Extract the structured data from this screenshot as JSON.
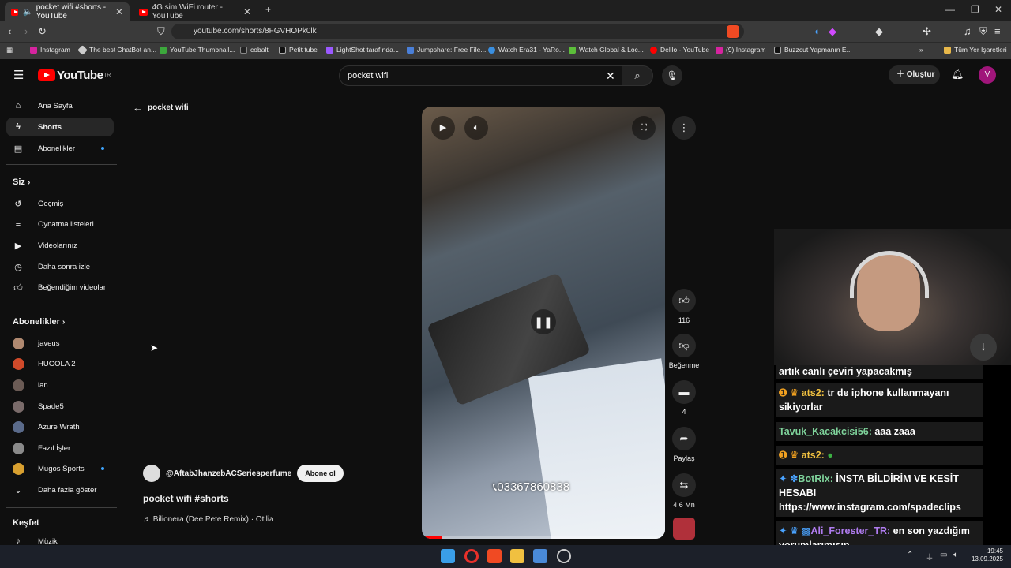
{
  "browser": {
    "tabs": [
      {
        "label": "pocket wifi #shorts - YouTube",
        "active": true
      },
      {
        "label": "4G sim WiFi router - YouTube",
        "active": false
      }
    ],
    "url": "youtube.com/shorts/8FGVHOPk0lk",
    "bookmarks": [
      "Instagram",
      "The best ChatBot an...",
      "YouTube Thumbnail...",
      "cobalt",
      "Petit tube",
      "LightShot tarafında...",
      "Jumpshare: Free File...",
      "Watch Era31 - YaRo...",
      "Watch Global & Loc...",
      "Delilo - YouTube",
      "(9) Instagram",
      "Buzzcut Yapmanın E..."
    ],
    "all_bookmarks": "Tüm Yer İşaretleri"
  },
  "youtube": {
    "logo_region": "TR",
    "search_value": "pocket wifi",
    "create_label": "Oluştur",
    "avatar_letter": "V",
    "sidebar": {
      "main": [
        "Ana Sayfa",
        "Shorts",
        "Abonelikler"
      ],
      "you_header": "Siz",
      "you_items": [
        "Geçmiş",
        "Oynatma listeleri",
        "Videolarınız",
        "Daha sonra izle",
        "Beğendiğim videolar"
      ],
      "subs_header": "Abonelikler",
      "subs": [
        "javeus",
        "HUGOLA 2",
        "ian",
        "Spade5",
        "Azure Wrath",
        "Fazıl İşler",
        "Mugos Sports"
      ],
      "show_more": "Daha fazla göster",
      "explore_header": "Keşfet",
      "explore_items": [
        "Müzik"
      ]
    },
    "back_label": "pocket wifi",
    "short": {
      "phone_overlay": "03367860838",
      "channel": "@AftabJhanzebACSeriesperfume",
      "subscribe_label": "Abone ol",
      "title": "pocket wifi #shorts",
      "music": "Bilionera (Dee Pete Remix) · Otilia",
      "progress": 0.08,
      "likes": "116",
      "dislike_label": "Beğenme",
      "comments": "4",
      "share_label": "Paylaş",
      "remix_count": "4,6 Mn"
    }
  },
  "chat": {
    "messages": [
      {
        "user": "",
        "text": "artık canlı çeviri yapacakmış"
      },
      {
        "user": "ats2:",
        "text": "tr de iphone kullanmayanı sikiyorlar",
        "color": "#f0c040"
      },
      {
        "user": "Tavuk_Kacakcisi56:",
        "text": "aaa zaaa",
        "color": "#7fd39b"
      },
      {
        "user": "ats2:",
        "text": "",
        "color": "#f0c040"
      },
      {
        "user": "BotRix:",
        "text": "İNSTA BİLDİRİM VE KESİT HESABI https://www.instagram.com/spadeclips",
        "color": "#7fd39b"
      },
      {
        "user": "Ali_Forester_TR:",
        "text": "en son yazdığım yorumlarımısın",
        "color": "#b07cf0"
      }
    ]
  },
  "taskbar": {
    "time": "19:45",
    "date": "13.09.2025"
  }
}
